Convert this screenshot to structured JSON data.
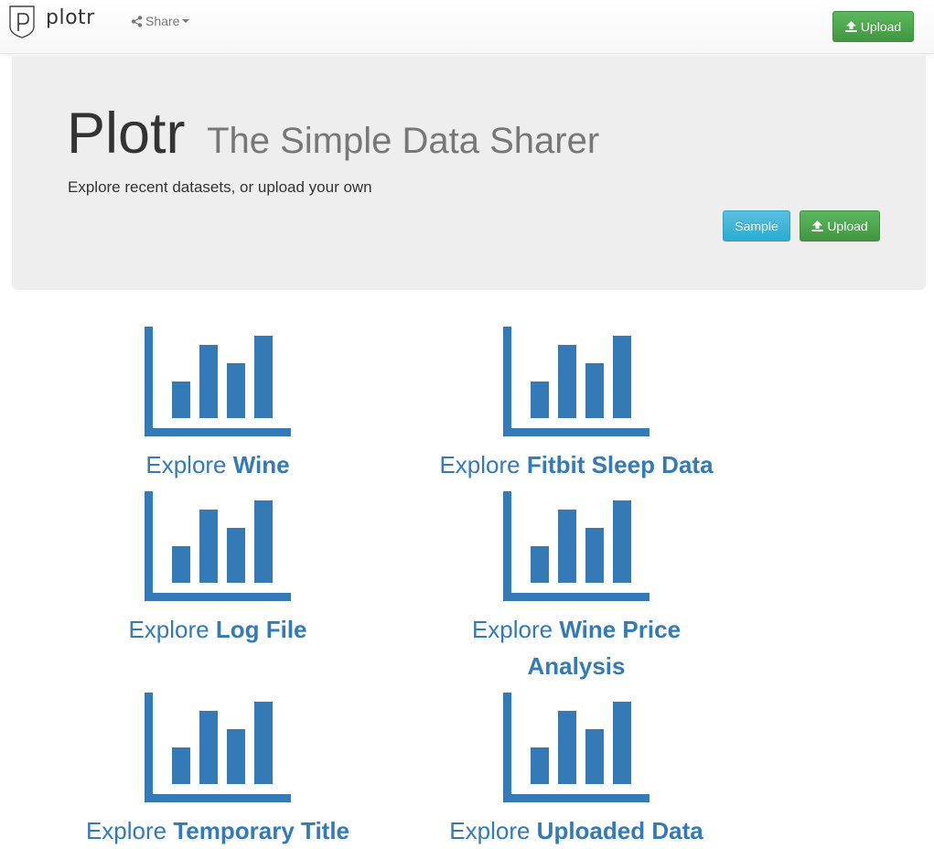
{
  "navbar": {
    "brand": "plotr",
    "share_label": "Share",
    "upload_label": "Upload"
  },
  "hero": {
    "title": "Plotr",
    "subtitle": "The Simple Data Sharer",
    "lead": "Explore recent datasets, or upload your own",
    "sample_label": "Sample",
    "upload_label": "Upload"
  },
  "datasets": [
    {
      "prefix": "Explore",
      "name": "Wine",
      "icon": "bar-chart-icon"
    },
    {
      "prefix": "Explore",
      "name": "Fitbit Sleep Data",
      "icon": "bar-chart-icon"
    },
    {
      "prefix": "Explore",
      "name": "Log File",
      "icon": "bar-chart-icon"
    },
    {
      "prefix": "Explore",
      "name": "Wine Price Analysis",
      "icon": "bar-chart-icon"
    },
    {
      "prefix": "Explore",
      "name": "Temporary Title",
      "icon": "bar-chart-icon"
    },
    {
      "prefix": "Explore",
      "name": "Uploaded Data",
      "icon": "bar-chart-icon"
    }
  ],
  "colors": {
    "link": "#337ab7",
    "success": "#5cb85c",
    "info": "#5bc0de",
    "jumbotron_bg": "#eeeeee"
  }
}
